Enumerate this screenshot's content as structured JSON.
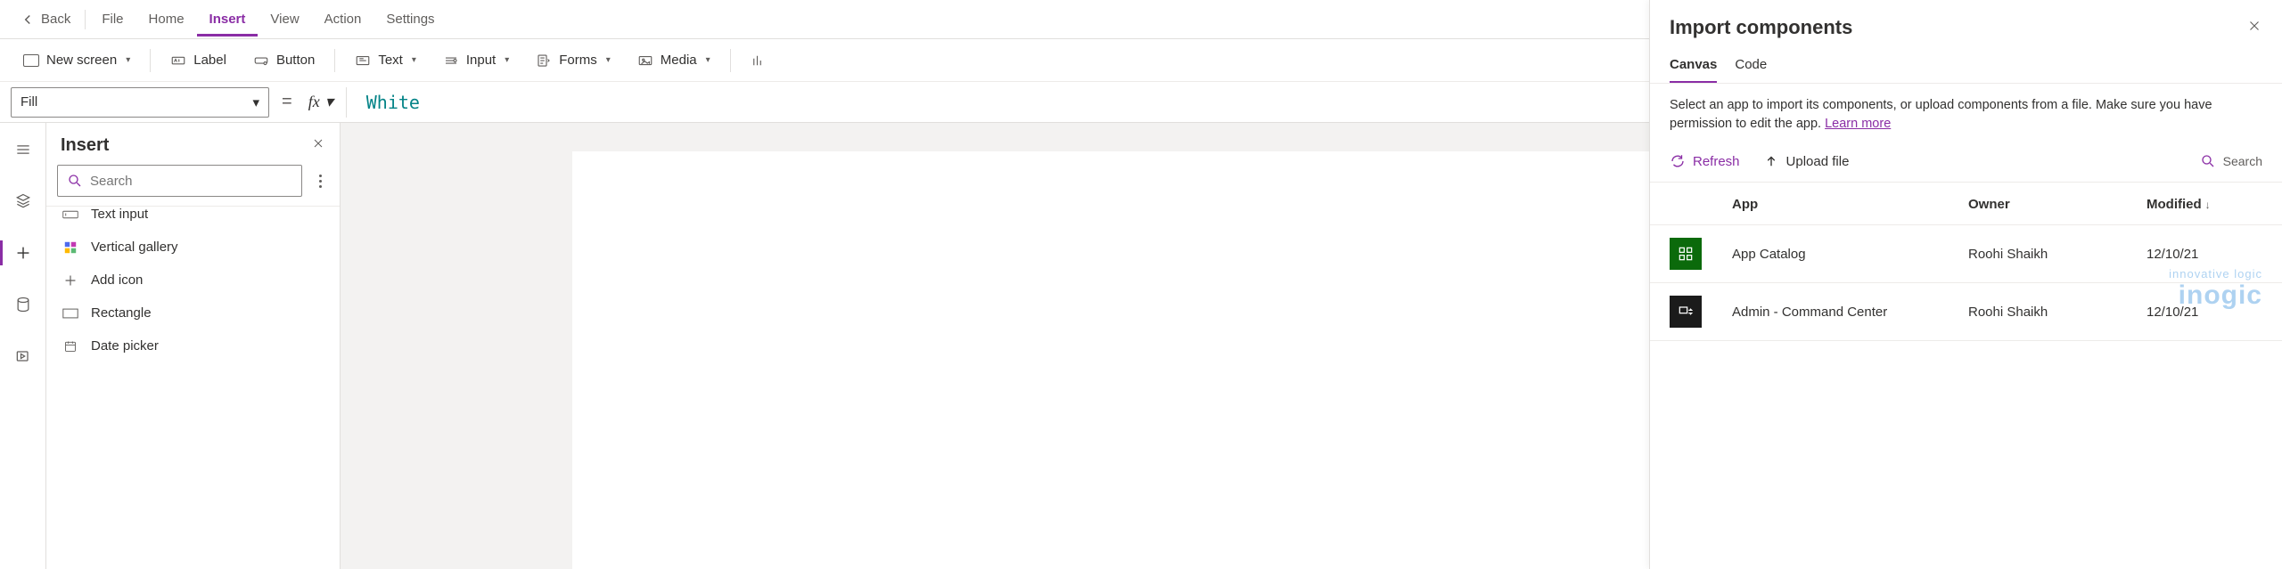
{
  "topbar": {
    "back": "Back",
    "menus": [
      "File",
      "Home",
      "Insert",
      "View",
      "Action",
      "Settings"
    ],
    "active_index": 2
  },
  "ribbon": {
    "new_screen": "New screen",
    "label": "Label",
    "button": "Button",
    "text": "Text",
    "input": "Input",
    "forms": "Forms",
    "media": "Media"
  },
  "formula": {
    "property": "Fill",
    "value": "White"
  },
  "insert_panel": {
    "title": "Insert",
    "search_placeholder": "Search",
    "items": [
      "Text input",
      "Vertical gallery",
      "Add icon",
      "Rectangle",
      "Date picker"
    ]
  },
  "flyout": {
    "title": "Import components",
    "tabs": [
      "Canvas",
      "Code"
    ],
    "active_tab": 0,
    "description": "Select an app to import its components, or upload components from a file. Make sure you have permission to edit the app. ",
    "learn_more": "Learn more",
    "refresh": "Refresh",
    "upload": "Upload file",
    "search_placeholder": "Search",
    "columns": {
      "app": "App",
      "owner": "Owner",
      "modified": "Modified"
    },
    "rows": [
      {
        "name": "App Catalog",
        "owner": "Roohi Shaikh",
        "modified": "12/10/21",
        "icon": "green"
      },
      {
        "name": "Admin - Command Center",
        "owner": "Roohi Shaikh",
        "modified": "12/10/21",
        "icon": "dark"
      }
    ]
  },
  "watermark": {
    "line1": "innovative logic",
    "line2": "inogic"
  }
}
